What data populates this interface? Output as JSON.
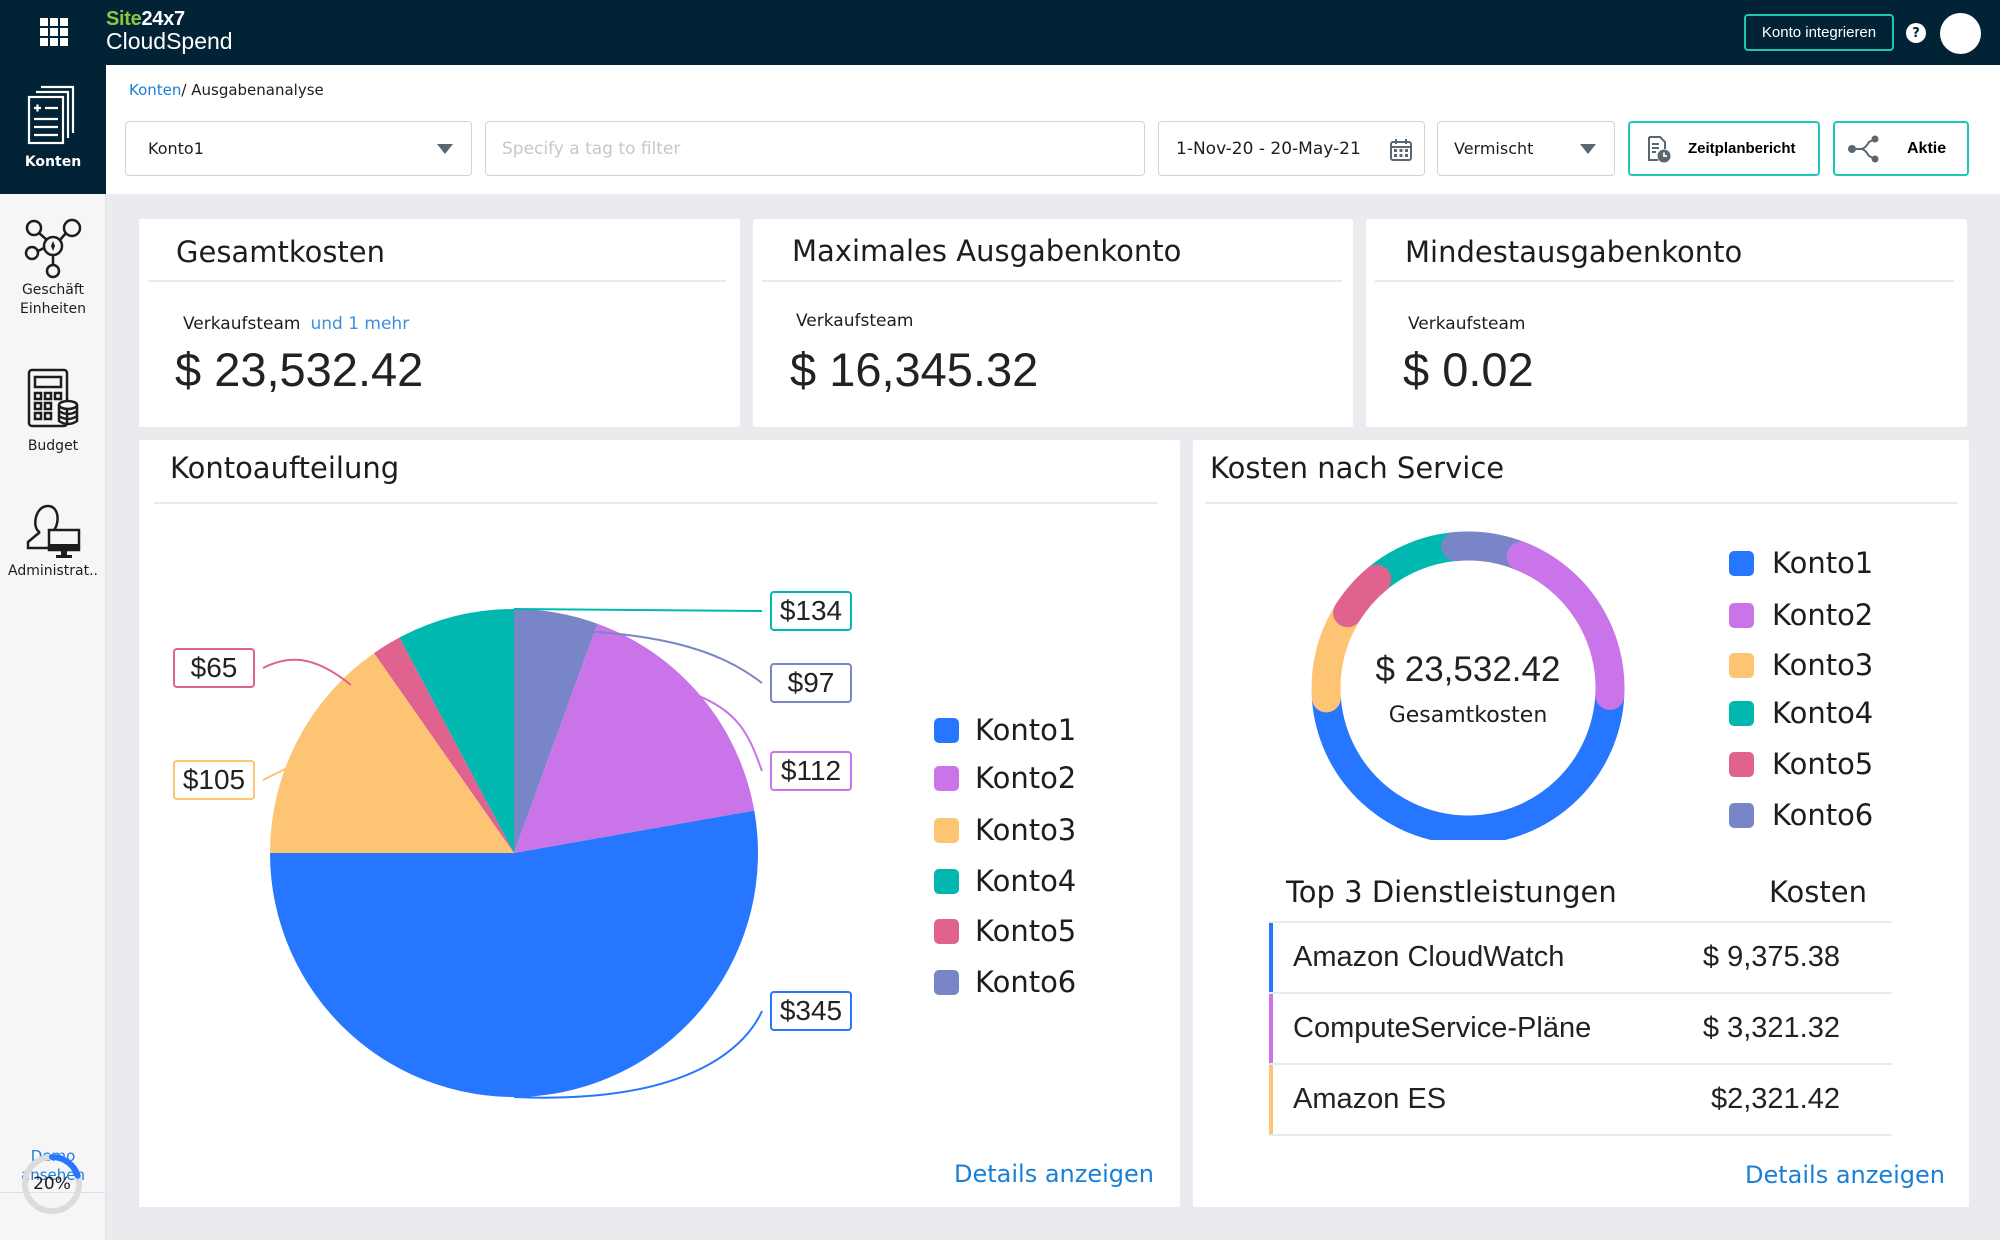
{
  "header": {
    "brand_site": "Site",
    "brand_num": "24x7",
    "brand_product": "CloudSpend",
    "integrate_button": "Konto integrieren",
    "help_glyph": "?"
  },
  "sidebar": {
    "items": [
      {
        "label": "Konten",
        "icon": "accounts-icon",
        "active": true
      },
      {
        "label_line1": "Geschäft",
        "label_line2": "Einheiten",
        "icon": "business-units-icon"
      },
      {
        "label": "Budget",
        "icon": "budget-calculator-icon"
      },
      {
        "label": "Administrat..",
        "icon": "admin-icon"
      }
    ],
    "demo_line1": "Demo",
    "demo_line2": "ansehen",
    "progress_percent": 20,
    "progress_label": "20%"
  },
  "breadcrumb": {
    "root": "Konten",
    "separator": "/",
    "current": "Ausgabenanalyse"
  },
  "filters": {
    "account_selected": "Konto1",
    "tag_placeholder": "Specify a tag to filter",
    "tag_value": "",
    "date_range": "1-Nov-20 - 20-May-21",
    "mode_selected": "Vermischt",
    "schedule_button": "Zeitplanbericht",
    "share_button": "Aktie"
  },
  "cards": {
    "total": {
      "title": "Gesamtkosten",
      "subtitle": "Verkaufsteam",
      "more": "und 1 mehr",
      "amount": "$ 23,532.42"
    },
    "max": {
      "title": "Maximales Ausgabenkonto",
      "subtitle": "Verkaufsteam",
      "amount": "$ 16,345.32"
    },
    "min": {
      "title": "Mindestausgabenkonto",
      "subtitle": "Verkaufsteam",
      "amount": "$ 0.02"
    }
  },
  "account_split": {
    "title": "Kontoaufteilung",
    "details_link": "Details anzeigen"
  },
  "service_costs": {
    "title": "Kosten nach Service",
    "center_amount": "$ 23,532.42",
    "center_label": "Gesamtkosten",
    "table_header_name": "Top 3 Dienstleistungen",
    "table_header_cost": "Kosten",
    "rows": [
      {
        "name": "Amazon CloudWatch",
        "cost": "$ 9,375.38",
        "color": "#2776ff"
      },
      {
        "name": "ComputeService-Pläne",
        "cost": "$ 3,321.32",
        "color": "#c974e8"
      },
      {
        "name": "Amazon ES",
        "cost": "$2,321.42",
        "color": "#fdc573"
      }
    ],
    "details_link": "Details anzeigen"
  },
  "colors": {
    "header_bg": "#022335",
    "accent_teal": "#1fc5b6",
    "link_blue": "#1a7fd6"
  },
  "chart_data": [
    {
      "type": "pie",
      "title": "Kontoaufteilung",
      "legend_position": "right",
      "categories": [
        "Konto1",
        "Konto2",
        "Konto3",
        "Konto4",
        "Konto5",
        "Konto6"
      ],
      "values": [
        345,
        112,
        105,
        134,
        65,
        97
      ],
      "data_labels": [
        "$345",
        "$112",
        "$105",
        "$134",
        "$65",
        "$97"
      ],
      "colors": [
        "#2776ff",
        "#c974e8",
        "#fdc573",
        "#00b8b0",
        "#e0628f",
        "#7885c6"
      ],
      "rendered_sweep_degrees": [
        190,
        60,
        55,
        28,
        7,
        20
      ]
    },
    {
      "type": "pie",
      "subtype": "donut",
      "title": "Kosten nach Service",
      "legend_position": "right",
      "center_text": "$ 23,532.42",
      "center_subtext": "Gesamtkosten",
      "categories": [
        "Konto1",
        "Konto2",
        "Konto3",
        "Konto4",
        "Konto5",
        "Konto6"
      ],
      "colors": [
        "#2776ff",
        "#c974e8",
        "#fdc573",
        "#00b8b0",
        "#e0628f",
        "#7885c6"
      ],
      "rendered_sweep_degrees": [
        173,
        71,
        36,
        38,
        18,
        30
      ]
    }
  ]
}
